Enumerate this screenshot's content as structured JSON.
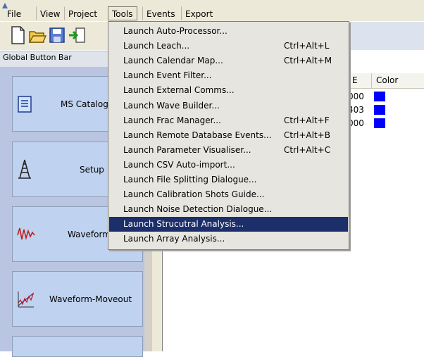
{
  "menubar": {
    "items": [
      {
        "label": "File"
      },
      {
        "label": "View"
      },
      {
        "label": "Project"
      },
      {
        "label": "Tools"
      },
      {
        "label": "Events"
      },
      {
        "label": "Export"
      }
    ]
  },
  "toolbar": {
    "icons": [
      "new-document-icon",
      "open-folder-icon",
      "save-icon",
      "import-icon"
    ]
  },
  "global_button_bar": {
    "title": "Global Button Bar",
    "buttons": [
      {
        "label": "MS Catalog",
        "icon": "catalog-icon"
      },
      {
        "label": "Setup",
        "icon": "tower-icon"
      },
      {
        "label": "Waveform",
        "icon": "waveform-icon"
      },
      {
        "label": "Waveform-Moveout",
        "icon": "moveout-icon"
      }
    ]
  },
  "table": {
    "headers": [
      "E",
      "Color"
    ],
    "rows": [
      {
        "value": "000",
        "color": "#0000ff"
      },
      {
        "value": "403",
        "color": "#0000ff"
      },
      {
        "value": "000",
        "color": "#0000ff"
      }
    ]
  },
  "tools_menu": {
    "items": [
      {
        "label": "Launch Auto-Processor...",
        "shortcut": ""
      },
      {
        "label": "Launch Leach...",
        "shortcut": "Ctrl+Alt+L"
      },
      {
        "label": "Launch Calendar Map...",
        "shortcut": "Ctrl+Alt+M"
      },
      {
        "label": "Launch Event Filter...",
        "shortcut": ""
      },
      {
        "label": "Launch External Comms...",
        "shortcut": ""
      },
      {
        "label": "Launch Wave Builder...",
        "shortcut": ""
      },
      {
        "label": "Launch Frac Manager...",
        "shortcut": "Ctrl+Alt+F"
      },
      {
        "label": "Launch Remote Database Events...",
        "shortcut": "Ctrl+Alt+B"
      },
      {
        "label": "Launch Parameter Visualiser...",
        "shortcut": "Ctrl+Alt+C"
      },
      {
        "label": "Launch CSV Auto-import...",
        "shortcut": ""
      },
      {
        "label": "Launch File Splitting Dialogue...",
        "shortcut": ""
      },
      {
        "label": "Launch Calibration Shots Guide...",
        "shortcut": ""
      },
      {
        "label": "Launch Noise Detection Dialogue...",
        "shortcut": ""
      },
      {
        "label": "Launch Strucutral Analysis...",
        "shortcut": "",
        "highlighted": true
      },
      {
        "label": "Launch Array Analysis...",
        "shortcut": ""
      }
    ]
  },
  "colors": {
    "highlight": "#1c2f6b",
    "panel": "#b9c5e1",
    "button": "#bfd2ef",
    "swatch": "#0000ff"
  }
}
